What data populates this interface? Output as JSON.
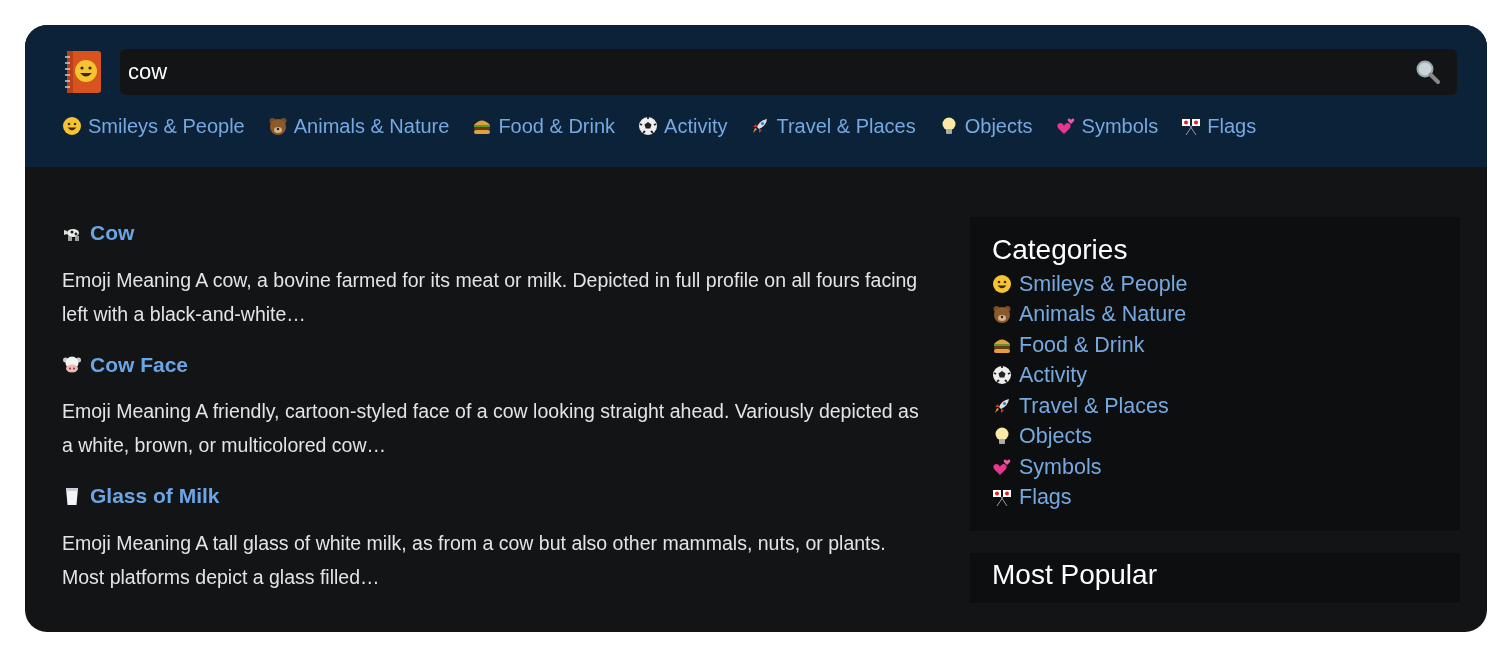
{
  "search": {
    "value": "cow"
  },
  "nav": [
    {
      "label": "Smileys & People"
    },
    {
      "label": "Animals & Nature"
    },
    {
      "label": "Food & Drink"
    },
    {
      "label": "Activity"
    },
    {
      "label": "Travel & Places"
    },
    {
      "label": "Objects"
    },
    {
      "label": "Symbols"
    },
    {
      "label": "Flags"
    }
  ],
  "results": [
    {
      "title": "Cow",
      "text": "Emoji Meaning A cow, a bovine farmed for its meat or milk. Depicted in full profile on all fours facing left with a black-and-white…"
    },
    {
      "title": "Cow Face",
      "text": "Emoji Meaning A friendly, cartoon-styled face of a cow looking straight ahead. Variously depicted as a white, brown, or multicolored cow…"
    },
    {
      "title": "Glass of Milk",
      "text": "Emoji Meaning A tall glass of white milk, as from a cow but also other mammals, nuts, or plants. Most platforms depict a glass filled…"
    }
  ],
  "sidebar": {
    "title": "Categories",
    "items": [
      {
        "label": "Smileys & People"
      },
      {
        "label": "Animals & Nature"
      },
      {
        "label": "Food & Drink"
      },
      {
        "label": "Activity"
      },
      {
        "label": "Travel & Places"
      },
      {
        "label": "Objects"
      },
      {
        "label": "Symbols"
      },
      {
        "label": "Flags"
      }
    ]
  },
  "popular": {
    "title": "Most Popular"
  }
}
